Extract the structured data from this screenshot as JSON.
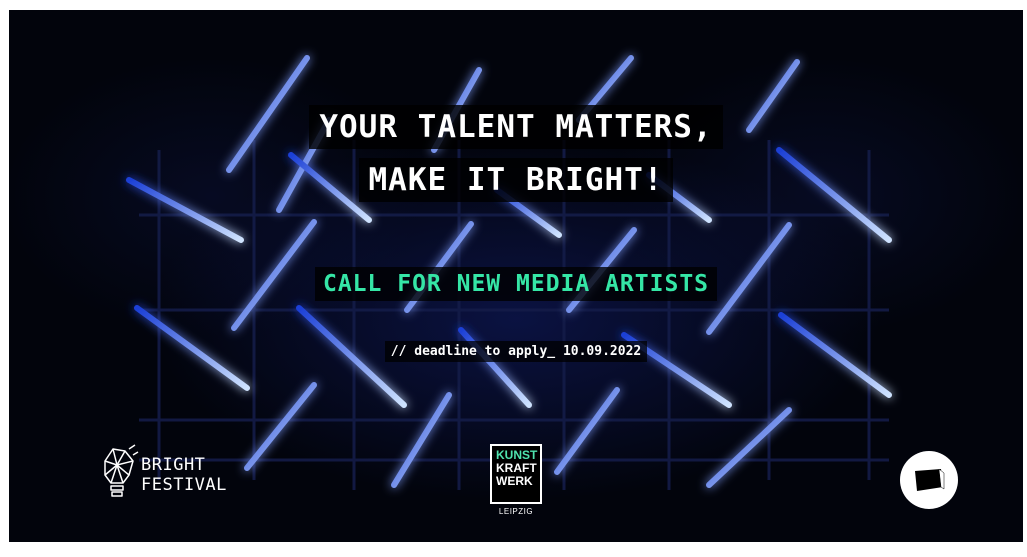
{
  "headline": {
    "line1": "YOUR TALENT MATTERS,",
    "line2": "MAKE IT BRIGHT!"
  },
  "call_text": "CALL FOR NEW MEDIA ARTISTS",
  "deadline_text": "// deadline to apply_ 10.09.2022",
  "logos": {
    "bright_festival": {
      "line1": "BRIGHT",
      "line2": "FESTIVAL",
      "icon": "lightbulb-icon"
    },
    "kunstkraftwerk": {
      "line1": "KUNST",
      "line2": "KRAFT",
      "line3": "WERK",
      "city": "LEIPZIG"
    },
    "partner_logo": {
      "icon": "screen-icon"
    }
  },
  "colors": {
    "background": "#02040c",
    "neon_blue": "#2a63ff",
    "neon_core": "#e8f2ff",
    "accent_green": "#35e6a6",
    "text": "#ffffff"
  }
}
